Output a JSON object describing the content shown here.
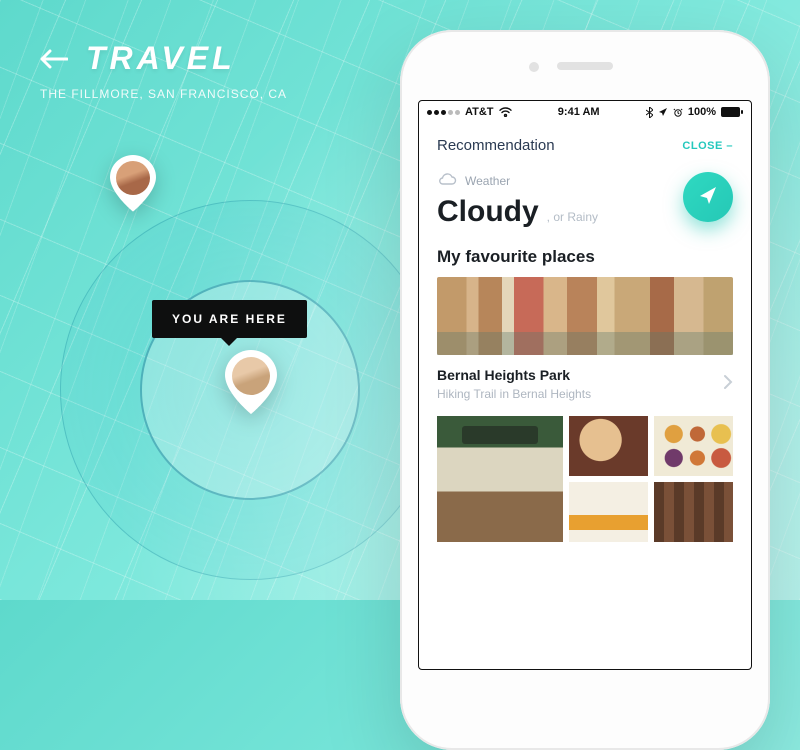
{
  "header": {
    "title": "TRAVEL",
    "subtitle": "THE FILLMORE, SAN FRANCISCO, CA"
  },
  "map": {
    "you_are_here_label": "YOU ARE HERE"
  },
  "status_bar": {
    "carrier": "AT&T",
    "time": "9:41 AM",
    "battery": "100%"
  },
  "panel": {
    "title": "Recommendation",
    "close_label": "CLOSE –"
  },
  "weather": {
    "label": "Weather",
    "value": "Cloudy",
    "sub": ", or Rainy"
  },
  "favourites": {
    "heading": "My favourite places"
  },
  "park": {
    "name": "Bernal Heights Park",
    "subtitle": "Hiking Trail in Bernal Heights"
  }
}
